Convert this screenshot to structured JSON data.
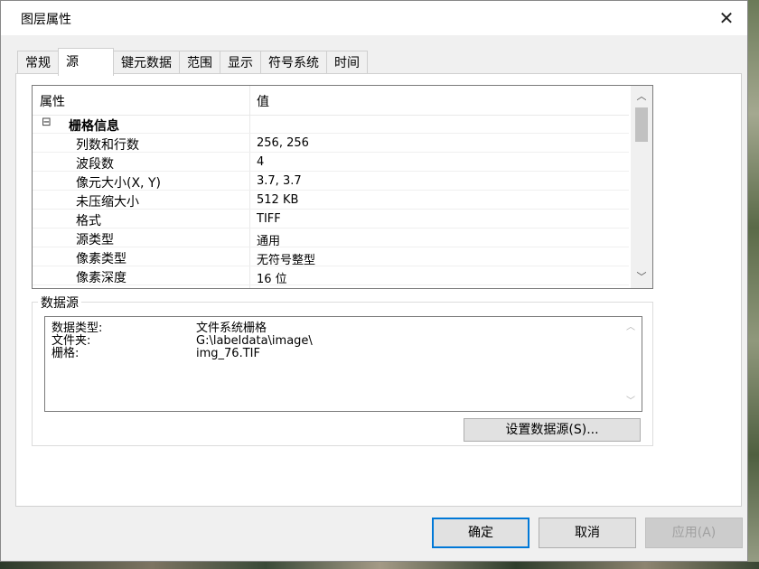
{
  "window": {
    "title": "图层属性",
    "close_glyph": "✕"
  },
  "tabs": [
    {
      "label": "常规"
    },
    {
      "label": "源",
      "active": true
    },
    {
      "label": "键元数据"
    },
    {
      "label": "范围"
    },
    {
      "label": "显示"
    },
    {
      "label": "符号系统"
    },
    {
      "label": "时间"
    }
  ],
  "property_grid": {
    "col_property": "属性",
    "col_value": "值",
    "group": {
      "collapse_glyph": "⊟",
      "label": "栅格信息"
    },
    "rows": [
      {
        "key": "列数和行数",
        "value": "256, 256"
      },
      {
        "key": "波段数",
        "value": "4"
      },
      {
        "key": "像元大小(X, Y)",
        "value": "3.7, 3.7"
      },
      {
        "key": "未压缩大小",
        "value": "512 KB"
      },
      {
        "key": "格式",
        "value": "TIFF"
      },
      {
        "key": "源类型",
        "value": "通用"
      },
      {
        "key": "像素类型",
        "value": "无符号整型"
      },
      {
        "key": "像素深度",
        "value": "16 位"
      }
    ],
    "scroll_up_glyph": "︿",
    "scroll_down_glyph": "﹀"
  },
  "data_source": {
    "group_label": "数据源",
    "lines": [
      {
        "label": "数据类型:",
        "value": "文件系统栅格"
      },
      {
        "label": "文件夹:",
        "value": "G:\\labeldata\\image\\"
      },
      {
        "label": "栅格:",
        "value": "img_76.TIF"
      }
    ],
    "scroll_up_glyph": "︿",
    "scroll_down_glyph": "﹀",
    "set_button_label": "设置数据源(S)..."
  },
  "buttons": {
    "ok": "确定",
    "cancel": "取消",
    "apply": "应用(A)"
  },
  "colors": {
    "focus_border": "#0078d7"
  }
}
